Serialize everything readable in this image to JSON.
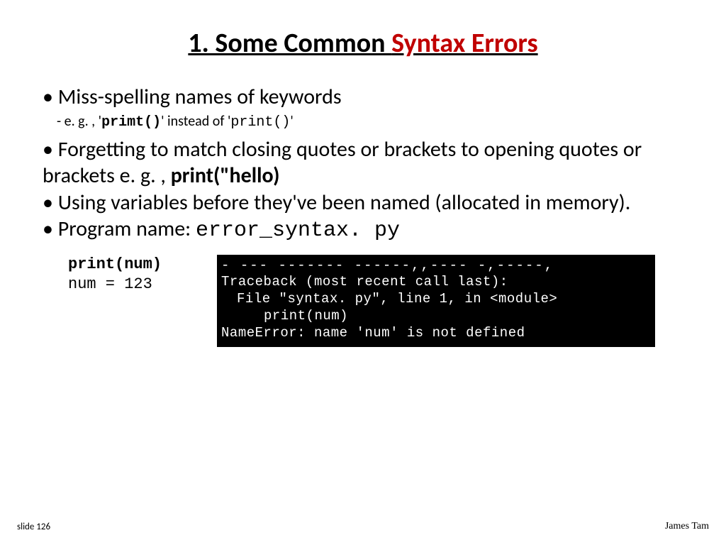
{
  "title": {
    "a": "1.  Some Common ",
    "b": "Syntax Errors"
  },
  "bullets": {
    "b1": "Miss-spelling names of keywords",
    "sub_pre": "e. g. , '",
    "sub_code1": "primt()",
    "sub_mid": "' instead of '",
    "sub_code2": "print()",
    "sub_post": "'",
    "b2a": "Forgetting to match closing quotes or brackets to opening quotes or brackets e. g. , ",
    "b2b": "print(\"hello)",
    "b3": "Using variables before they've been named (allocated in memory).",
    "b4a": "Program name: ",
    "b4b": "error_syntax. py"
  },
  "code": {
    "l1": "print(num)",
    "l2": "num = 123"
  },
  "terminal": {
    "t0": "- --- ------- ------,,---- -,-----,",
    "t1": "Traceback (most recent call last):",
    "t2": "File \"syntax. py\", line 1, in <module>",
    "t3": "print(num)",
    "t4": "NameError: name 'num' is not defined"
  },
  "footer": {
    "left": "slide 126",
    "right": "James Tam"
  }
}
